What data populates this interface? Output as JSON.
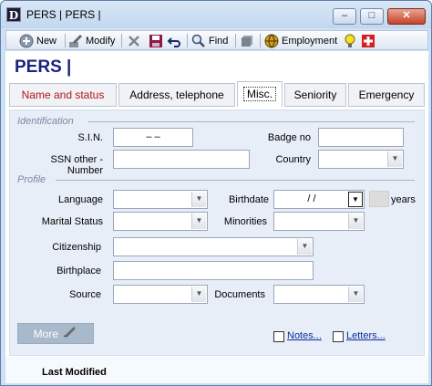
{
  "window": {
    "title": "PERS | PERS |",
    "buttons": {
      "minimize": "–",
      "maximize": "□",
      "close": "✕"
    }
  },
  "toolbar": {
    "new_label": "New",
    "modify_label": "Modify",
    "find_label": "Find",
    "employment_label": "Employment"
  },
  "page": {
    "title": "PERS |"
  },
  "tabs": [
    {
      "label": "Name and status",
      "active": false
    },
    {
      "label": "Address, telephone",
      "active": false
    },
    {
      "label": "Misc.",
      "active": true
    },
    {
      "label": "Seniority",
      "active": false
    },
    {
      "label": "Emergency",
      "active": false
    }
  ],
  "identification": {
    "section_label": "Identification",
    "sin_label": "S.I.N.",
    "sin_value": "–  –",
    "badge_label": "Badge no",
    "badge_value": "",
    "ssn_other_label": "SSN other - Number",
    "ssn_other_value": "",
    "country_label": "Country",
    "country_value": ""
  },
  "profile": {
    "section_label": "Profile",
    "language_label": "Language",
    "language_value": "",
    "birthdate_label": "Birthdate",
    "birthdate_value": "/     /",
    "years_label": "years",
    "marital_label": "Marital Status",
    "marital_value": "",
    "minorities_label": "Minorities",
    "minorities_value": "",
    "citizenship_label": "Citizenship",
    "citizenship_value": "",
    "birthplace_label": "Birthplace",
    "birthplace_value": "",
    "source_label": "Source",
    "source_value": "",
    "documents_label": "Documents",
    "documents_value": ""
  },
  "actions": {
    "more_label": "More",
    "notes_label": "Notes...",
    "letters_label": "Letters..."
  },
  "footer": {
    "last_modified_label": "Last Modified"
  }
}
